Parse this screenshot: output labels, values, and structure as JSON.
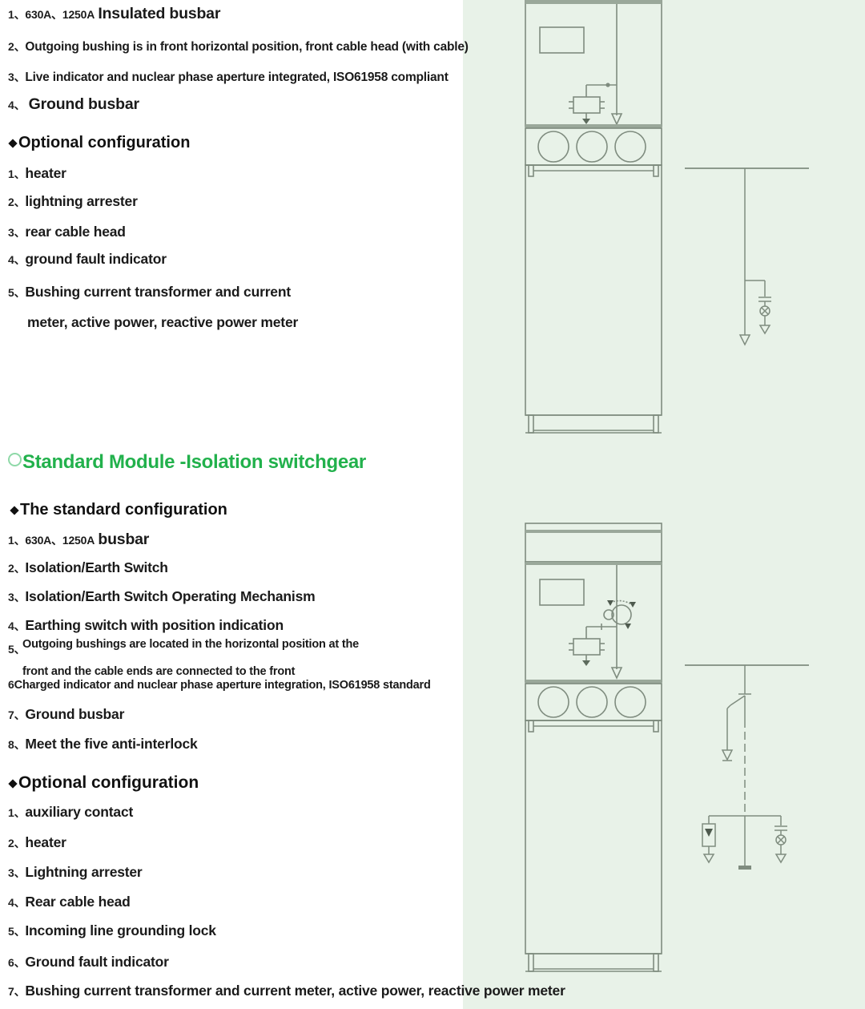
{
  "page": {
    "background_color": "#ffffff",
    "panel_color": "#e8f2e8",
    "accent_color": "#22b14c",
    "line_color": "#7f8c7f"
  },
  "top_section": {
    "standard_items": [
      {
        "num": "1、",
        "amp": "630A、1250A",
        "text": "Insulated busbar"
      },
      {
        "num": "2、",
        "text": "Outgoing bushing is in front horizontal position, front cable head (with cable)"
      },
      {
        "num": "3、",
        "text": "Live indicator and nuclear phase aperture integrated, ISO61958 compliant"
      },
      {
        "num": "4、",
        "text": "Ground busbar"
      }
    ],
    "optional_heading": "Optional configuration",
    "optional_items": [
      {
        "num": "1、",
        "text": "heater"
      },
      {
        "num": "2、",
        "text": "lightning arrester"
      },
      {
        "num": "3、",
        "text": "rear cable head"
      },
      {
        "num": "4、",
        "text": "ground fault indicator"
      },
      {
        "num": "5、",
        "text": "Bushing current transformer and current"
      },
      {
        "num": "",
        "text": "meter, active power, reactive power meter"
      }
    ]
  },
  "bottom_section": {
    "heading": "Standard Module -Isolation switchgear",
    "heading_icon": "ring-icon",
    "standard_heading": "The standard configuration",
    "standard_items": [
      {
        "num": "1、",
        "amp": "630A、1250A",
        "text": "busbar"
      },
      {
        "num": "2、",
        "text": "Isolation/Earth Switch"
      },
      {
        "num": "3、",
        "text": "Isolation/Earth Switch Operating Mechanism"
      },
      {
        "num": "4、",
        "text": "Earthing switch with position indication"
      },
      {
        "num": "5、",
        "text": "Outgoing bushings are located in the horizontal position at the"
      },
      {
        "num": "",
        "text": "front  and the cable ends are connected to the front"
      },
      {
        "num": "6",
        "text": "Charged indicator and nuclear phase aperture integration, ISO61958 standard"
      },
      {
        "num": "7、",
        "text": "Ground busbar"
      },
      {
        "num": "8、",
        "text": "Meet the five anti-interlock"
      }
    ],
    "optional_heading": "Optional configuration",
    "optional_items": [
      {
        "num": "1、",
        "text": "auxiliary contact"
      },
      {
        "num": "2、",
        "text": "heater"
      },
      {
        "num": "3、",
        "text": "Lightning arrester"
      },
      {
        "num": "4、",
        "text": "Rear cable head"
      },
      {
        "num": "5、",
        "text": "Incoming line grounding lock"
      },
      {
        "num": "6、",
        "text": "Ground fault indicator"
      },
      {
        "num": "7、",
        "text": "Bushing current transformer and current meter, active power, reactive power meter"
      }
    ]
  },
  "drawings": {
    "top_cabinet": "cabinet-elevation-drawing",
    "top_schematic": "single-line-diagram",
    "bottom_cabinet": "cabinet-elevation-drawing",
    "bottom_schematic": "single-line-diagram"
  }
}
